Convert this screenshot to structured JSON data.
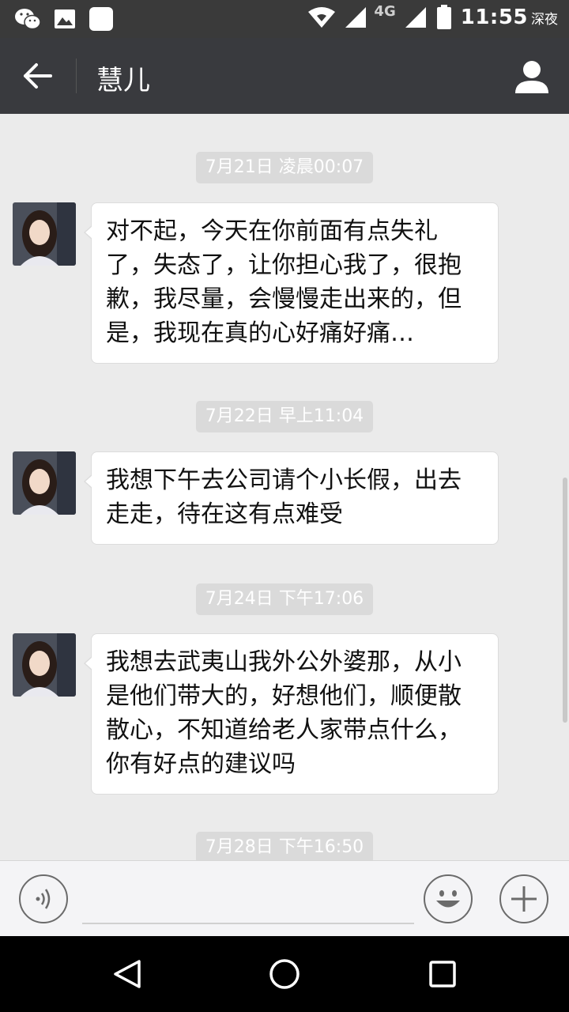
{
  "status_bar": {
    "network_label": "4G",
    "time": "11:55",
    "period": "深夜",
    "icons": [
      "wechat-icon",
      "gallery-icon",
      "app-icon",
      "wifi-icon",
      "signal-icon",
      "battery-icon"
    ]
  },
  "header": {
    "title": "慧儿",
    "back_icon": "arrow-left-icon",
    "profile_icon": "person-icon"
  },
  "messages": [
    {
      "timestamp": "7月21日 凌晨00:07",
      "text": "对不起，今天在你前面有点失礼了，失态了，让你担心我了，很抱歉，我尽量，会慢慢走出来的，但是，我现在真的心好痛好痛…"
    },
    {
      "timestamp": "7月22日 早上11:04",
      "text": "我想下午去公司请个小长假，出去走走，待在这有点难受"
    },
    {
      "timestamp": "7月24日 下午17:06",
      "text": "我想去武夷山我外公外婆那，从小是他们带大的，好想他们，顺便散散心，不知道给老人家带点什么，你有好点的建议吗"
    },
    {
      "timestamp": "7月28日 下午16:50",
      "text": ""
    }
  ],
  "input_bar": {
    "placeholder": "",
    "value": "",
    "voice_icon": "voice-icon",
    "emoji_icon": "smiley-icon",
    "plus_icon": "plus-icon"
  },
  "nav_bar": {
    "icons": [
      "nav-back-icon",
      "nav-home-icon",
      "nav-recents-icon"
    ]
  },
  "colors": {
    "title_bar": "#393a3e",
    "status_bar": "#3a3a3a",
    "chat_background": "#ebebeb",
    "timestamp_pill": "#dadada",
    "bubble": "#ffffff"
  }
}
